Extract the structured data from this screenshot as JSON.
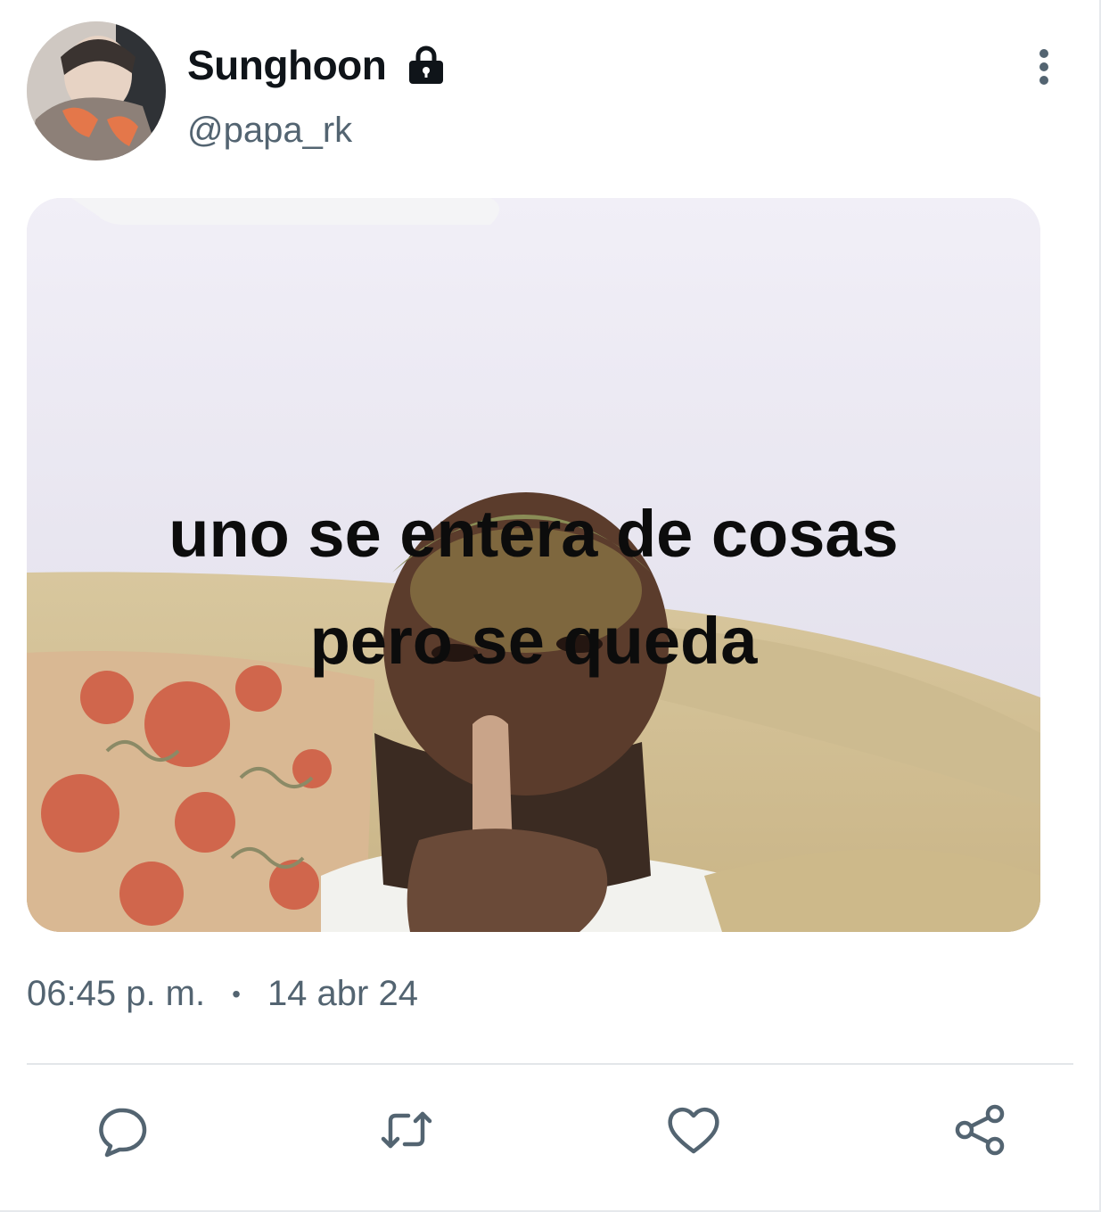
{
  "author": {
    "display_name": "Sunghoon",
    "handle": "@papa_rk",
    "protected": true
  },
  "post": {
    "image_caption_line1": "uno se entera de cosas",
    "image_caption_line2": "pero se queda",
    "time": "06:45 p. m.",
    "separator": "•",
    "date": "14 abr 24"
  },
  "icons": {
    "lock": "lock-icon",
    "more": "more-vertical-icon",
    "reply": "reply-icon",
    "repost": "repost-icon",
    "like": "heart-icon",
    "share": "share-icon"
  },
  "colors": {
    "text_primary": "#0f1419",
    "text_secondary": "#536471",
    "divider": "#e3e6e9"
  }
}
